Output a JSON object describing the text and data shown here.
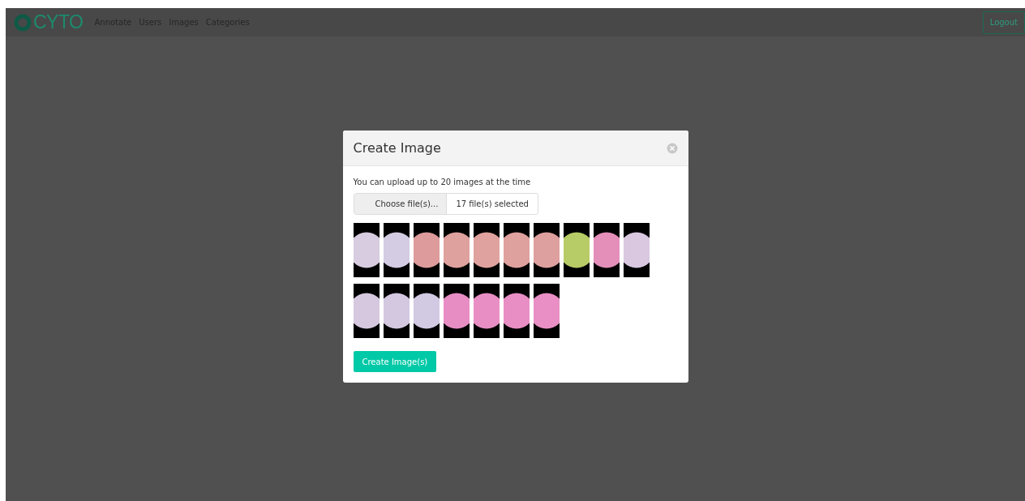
{
  "navbar": {
    "logo": "CYTO",
    "links": [
      "Annotate",
      "Users",
      "Images",
      "Categories"
    ],
    "logout": "Logout"
  },
  "modal": {
    "title": "Create Image",
    "hint": "You can upload up to 20 images at the time",
    "file_button": "Choose file(s)...",
    "file_status": "17 file(s) selected",
    "thumbnails": [
      {
        "color": "#d8cce0"
      },
      {
        "color": "#d4cce2"
      },
      {
        "color": "#dd9b9b"
      },
      {
        "color": "#dfa19e"
      },
      {
        "color": "#e0a29e"
      },
      {
        "color": "#dfa19e"
      },
      {
        "color": "#dea09e"
      },
      {
        "color": "#b7cc66"
      },
      {
        "color": "#e48fba"
      },
      {
        "color": "#d9c8e0"
      },
      {
        "color": "#d6c8de"
      },
      {
        "color": "#d3c8e0"
      },
      {
        "color": "#d2c9e3"
      },
      {
        "color": "#e88dc4"
      },
      {
        "color": "#e98ec4"
      },
      {
        "color": "#e88ec4"
      },
      {
        "color": "#e98fc5"
      }
    ],
    "submit": "Create Image(s)"
  }
}
